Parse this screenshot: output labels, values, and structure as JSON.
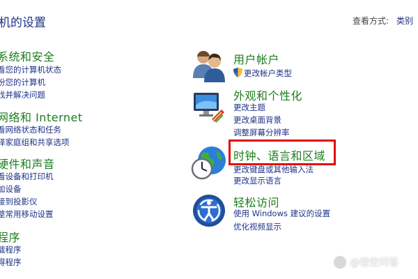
{
  "header": {
    "title": "机的设置",
    "view_label": "查看方式:",
    "view_value": "类别"
  },
  "left_categories": [
    {
      "title": "系统和安全",
      "links": [
        "看您的计算机状态",
        "份您的计算机",
        "找并解决问题"
      ]
    },
    {
      "title": "网络和 Internet",
      "links": [
        "看网络状态和任务",
        "择家庭组和共享选项"
      ]
    },
    {
      "title": "硬件和声音",
      "links": [
        "看设备和打印机",
        "加设备",
        "接到投影仪",
        "整常用移动设置"
      ]
    },
    {
      "title": "程序",
      "links": [
        "载程序",
        "得程序"
      ]
    }
  ],
  "right_categories": [
    {
      "title": "用户帐户",
      "icon": "users-icon",
      "links": [
        "更改帐户类型"
      ]
    },
    {
      "title": "外观和个性化",
      "icon": "monitor-paint-icon",
      "links": [
        "更改主题",
        "更改桌面背景",
        "调整屏幕分辨率"
      ]
    },
    {
      "title": "时钟、语言和区域",
      "icon": "globe-clock-icon",
      "links": [
        "更改键盘或其他输入法",
        "更改显示语言"
      ]
    },
    {
      "title": "轻松访问",
      "icon": "ease-of-access-icon",
      "links": [
        "使用 Windows 建议的设置",
        "优化视频显示"
      ]
    }
  ],
  "watermark": {
    "text": "@悟空问答"
  },
  "colors": {
    "category_green": "#1d7d1d",
    "link_blue": "#1e3287",
    "highlight_red": "#e10a0a"
  }
}
